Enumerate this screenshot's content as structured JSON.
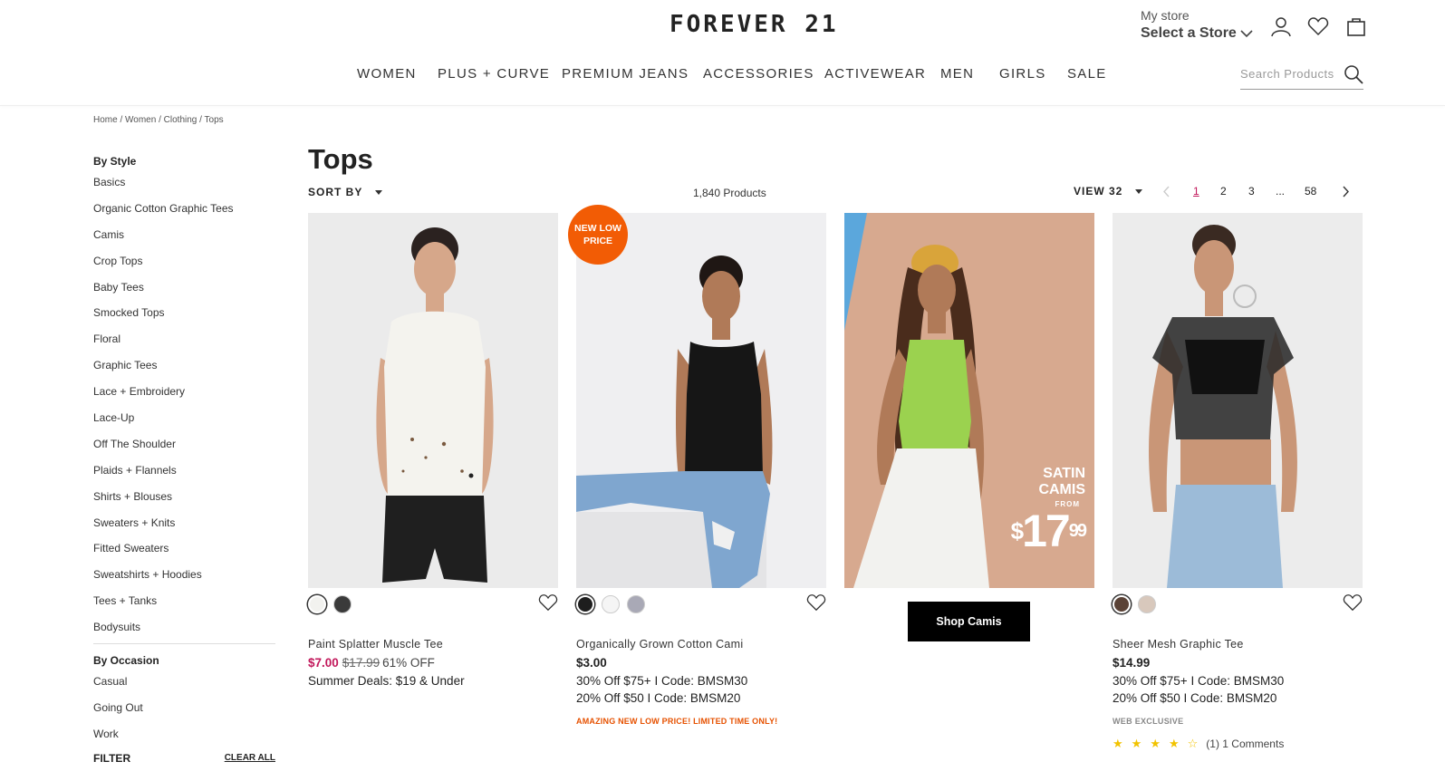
{
  "header": {
    "logo": "FOREVER 21",
    "store_label": "My store",
    "store_select": "Select a Store",
    "icons": [
      "account-icon",
      "wishlist-heart-icon",
      "shopping-bag-icon"
    ]
  },
  "nav": {
    "items": [
      "WOMEN",
      "PLUS + CURVE",
      "PREMIUM JEANS",
      "ACCESSORIES",
      "ACTIVEWEAR",
      "MEN",
      "GIRLS",
      "SALE"
    ],
    "search_placeholder": "Search Products"
  },
  "breadcrumb": [
    "Home",
    "Women",
    "Clothing",
    "Tops"
  ],
  "sidebar": {
    "style_heading": "By Style",
    "style_items": [
      "Basics",
      "Organic Cotton Graphic Tees",
      "Camis",
      "Crop Tops",
      "Baby Tees",
      "Smocked Tops",
      "Floral",
      "Graphic Tees",
      "Lace + Embroidery",
      "Lace-Up",
      "Off The Shoulder",
      "Plaids + Flannels",
      "Shirts + Blouses",
      "Sweaters + Knits",
      "Fitted Sweaters",
      "Sweatshirts + Hoodies",
      "Tees + Tanks",
      "Bodysuits"
    ],
    "occasion_heading": "By Occasion",
    "occasion_items": [
      "Casual",
      "Going Out",
      "Work"
    ],
    "filter_label": "FILTER",
    "clear_all": "CLEAR ALL"
  },
  "main": {
    "title": "Tops",
    "sort_label": "SORT BY",
    "product_count": "1,840 Products",
    "view_label": "VIEW 32",
    "pages": [
      "1",
      "2",
      "3",
      "...",
      "58"
    ],
    "current_page": "1"
  },
  "products": [
    {
      "name": "Paint Splatter Muscle Tee",
      "sale_price": "$7.00",
      "original_price": "$17.99",
      "discount": "61% OFF",
      "promo1": "Summer Deals: $19 & Under",
      "swatches": [
        "#f2f2ef",
        "#3a3a3a"
      ]
    },
    {
      "badge_line1": "NEW LOW",
      "badge_line2": "PRICE",
      "name": "Organically Grown Cotton Cami",
      "price": "$3.00",
      "promo1": "30% Off $75+ I Code: BMSM30",
      "promo2": "20% Off $50 I Code: BMSM20",
      "note": "AMAZING NEW LOW PRICE! LIMITED TIME ONLY!",
      "swatches": [
        "#1e1e1e",
        "#f5f5f5",
        "#a9a9b6"
      ]
    },
    {
      "promo_title1": "SATIN",
      "promo_title2": "CAMIS",
      "promo_from": "FROM",
      "promo_dollar": "$",
      "promo_price": "17",
      "promo_cents": "99",
      "button": "Shop Camis"
    },
    {
      "name": "Sheer Mesh Graphic Tee",
      "price": "$14.99",
      "promo1": "30% Off $75+ I Code: BMSM30",
      "promo2": "20% Off $50 I Code: BMSM20",
      "note": "WEB EXCLUSIVE",
      "rating": 4,
      "rating_count": "(1)",
      "comments": "1 Comments",
      "swatches": [
        "#5a4236",
        "#d8c8bc"
      ]
    }
  ],
  "colors": {
    "accent_pink": "#c2185b",
    "badge_orange": "#f25c05",
    "star_yellow": "#f2c300"
  }
}
